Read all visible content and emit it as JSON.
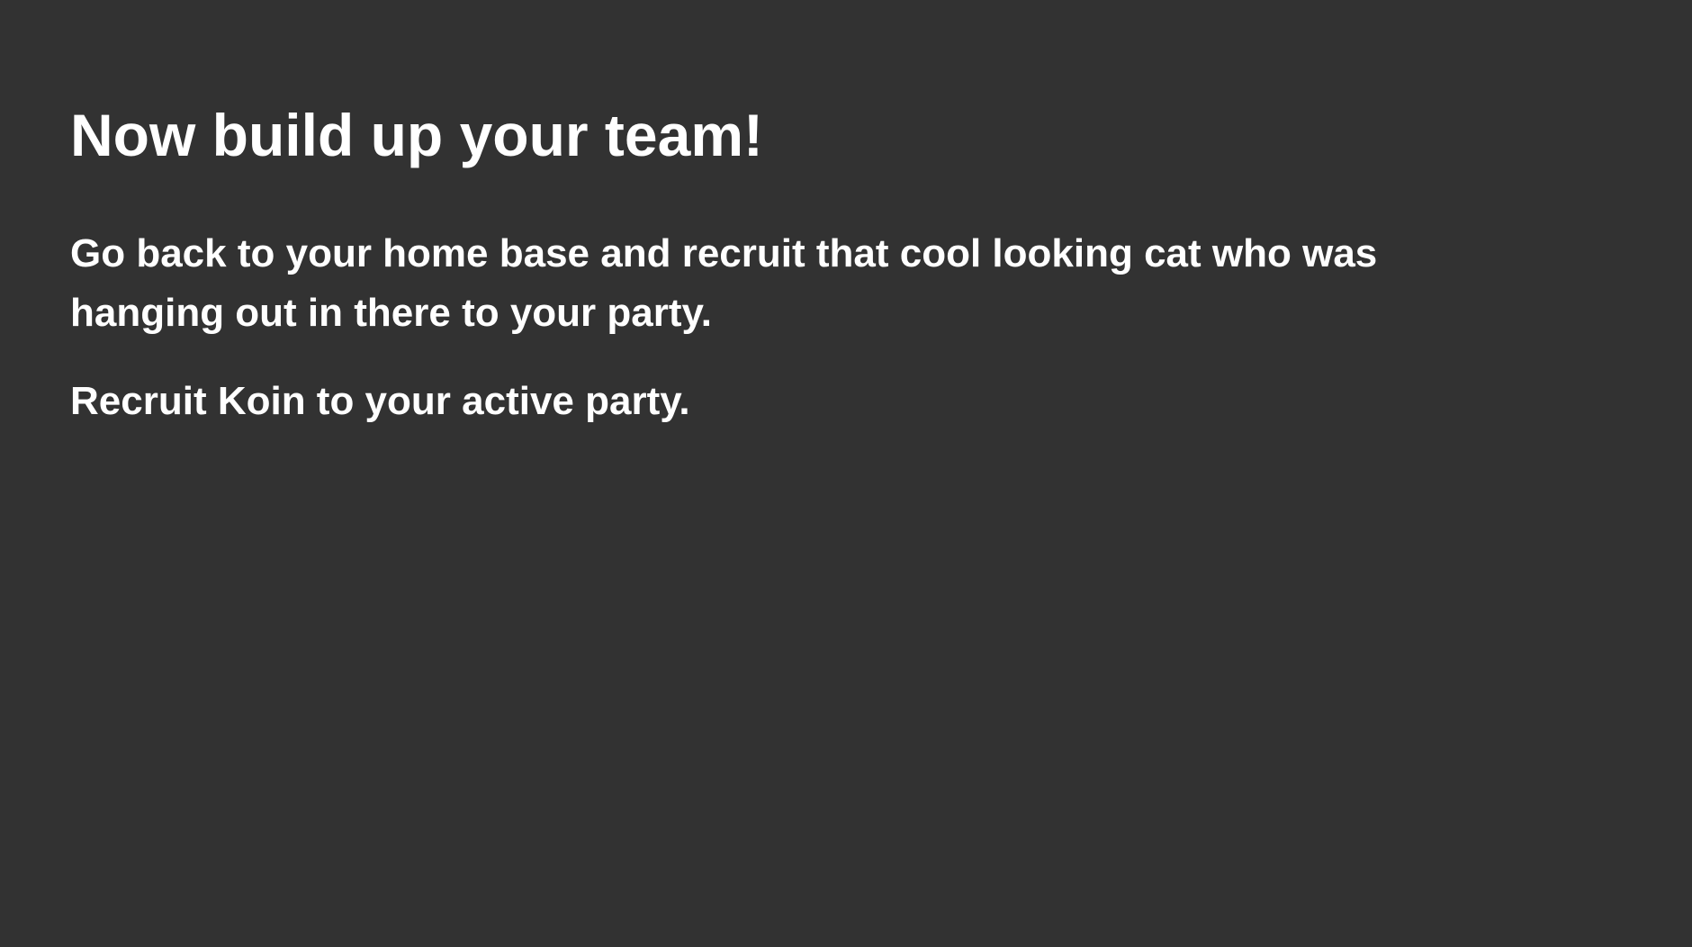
{
  "quest": {
    "title": "Now build up your team!",
    "description": "Go back to your home base and recruit that cool looking cat who was hanging out in there to your party.",
    "objective": "Recruit Koin to your active party."
  },
  "colors": {
    "background": "#323232",
    "text": "#ffffff"
  }
}
